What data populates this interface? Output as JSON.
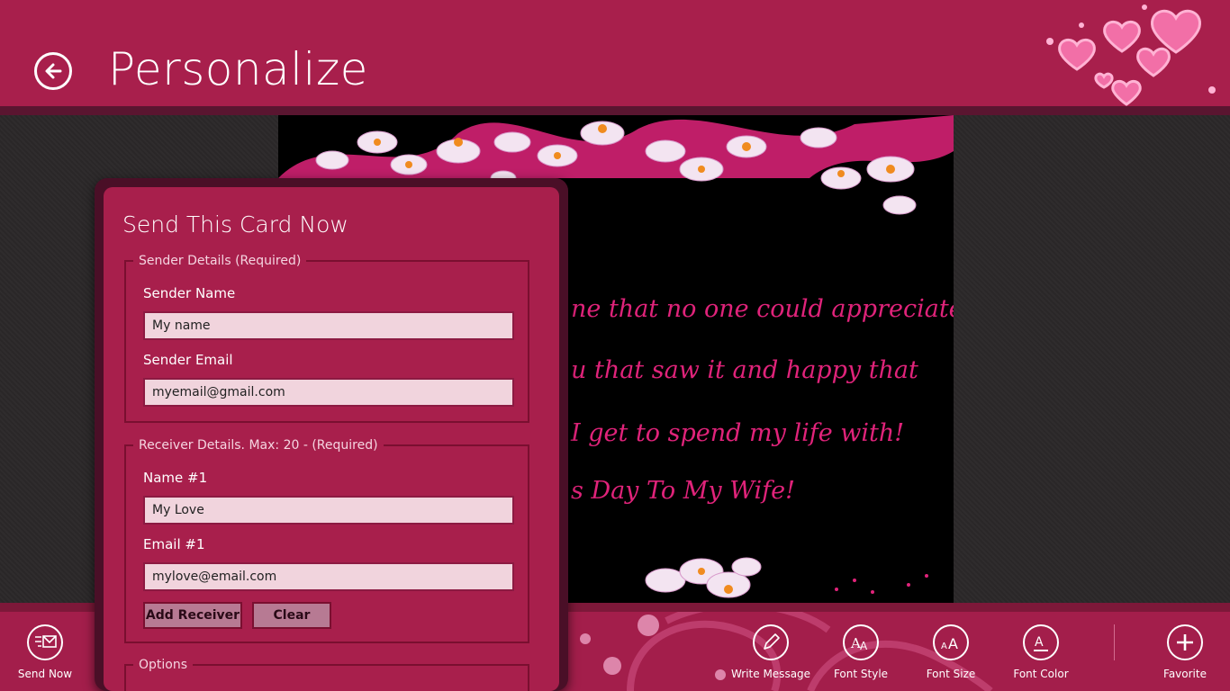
{
  "header": {
    "title": "Personalize",
    "back_icon": "arrow-left-icon"
  },
  "card": {
    "lines": [
      "ne that no one could appreciate.",
      "u that saw it and happy that",
      "I get to spend my life with!",
      "s Day To My Wife!"
    ],
    "text_color": "#e0237a"
  },
  "dialog": {
    "title": "Send This Card Now",
    "sender": {
      "legend": "Sender Details (Required)",
      "name_label": "Sender Name",
      "name_value": "My name",
      "email_label": "Sender Email",
      "email_value": "myemail@gmail.com"
    },
    "receiver": {
      "legend": "Receiver Details. Max: 20 - (Required)",
      "name_label": "Name #1",
      "name_value": "My Love",
      "email_label": "Email #1",
      "email_value": "mylove@email.com",
      "add_label": "Add Receiver",
      "clear_label": "Clear"
    },
    "options": {
      "legend": "Options"
    }
  },
  "appbar": {
    "items": [
      {
        "label": "Send Now",
        "icon": "send-mail-icon"
      },
      {
        "label": "Write Message",
        "icon": "pencil-icon"
      },
      {
        "label": "Font Style",
        "icon": "font-style-icon"
      },
      {
        "label": "Font Size",
        "icon": "font-size-icon"
      },
      {
        "label": "Font Color",
        "icon": "font-color-icon"
      },
      {
        "label": "Favorite",
        "icon": "plus-icon"
      }
    ]
  },
  "colors": {
    "accent": "#a81f4c",
    "dark_accent": "#4a0f27",
    "input_bg": "#f1d4dd"
  }
}
